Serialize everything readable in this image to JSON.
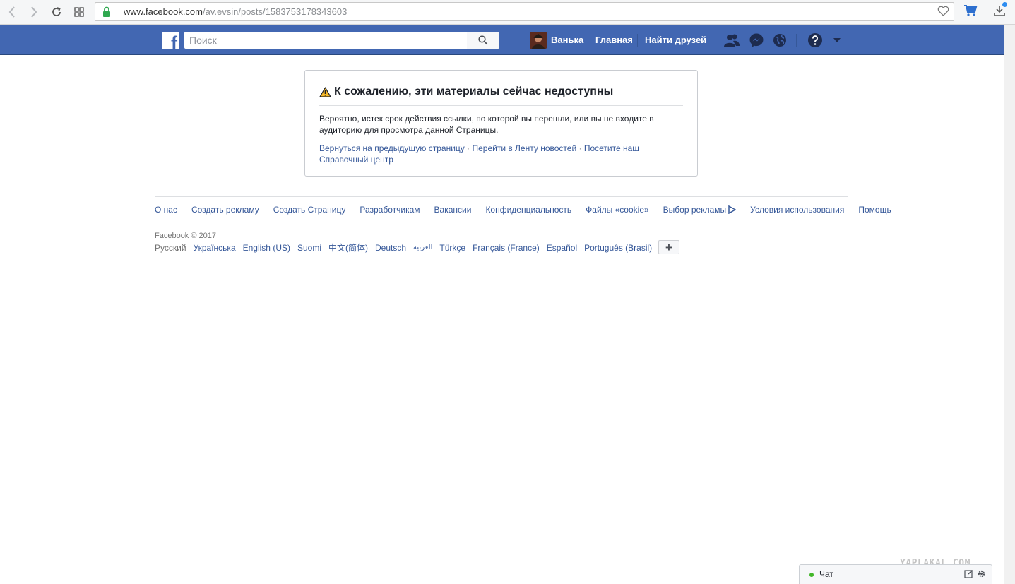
{
  "browser": {
    "url_host": "www.facebook.com",
    "url_path": "/av.evsin/posts/1583753178343603"
  },
  "header": {
    "logo": "f",
    "search_placeholder": "Поиск",
    "user_name": "Ванька",
    "home": "Главная",
    "find_friends": "Найти друзей"
  },
  "error": {
    "title": "К сожалению, эти материалы сейчас недоступны",
    "text": "Вероятно, истек срок действия ссылки, по которой вы перешли, или вы не входите в аудиторию для просмотра данной Страницы.",
    "link_back": "Вернуться на предыдущую страницу",
    "separator": " · ",
    "link_feed": "Перейти в Ленту новостей",
    "link_help": "Посетите наш Справочный центр"
  },
  "footer": {
    "links": [
      "О нас",
      "Создать рекламу",
      "Создать Страницу",
      "Разработчикам",
      "Вакансии",
      "Конфиденциальность",
      "Файлы «cookie»",
      "Выбор рекламы",
      "Условия использования",
      "Помощь"
    ],
    "copyright": "Facebook © 2017",
    "languages": [
      "Русский",
      "Українська",
      "English (US)",
      "Suomi",
      "中文(简体)",
      "Deutsch",
      "العربية",
      "Türkçe",
      "Français (France)",
      "Español",
      "Português (Brasil)"
    ],
    "more_languages": "+"
  },
  "chat": {
    "label": "Чат"
  },
  "watermark": "YAPLAKAL.COM",
  "colors": {
    "brand": "#4267b2",
    "link": "#365899",
    "online": "#42b72a"
  }
}
